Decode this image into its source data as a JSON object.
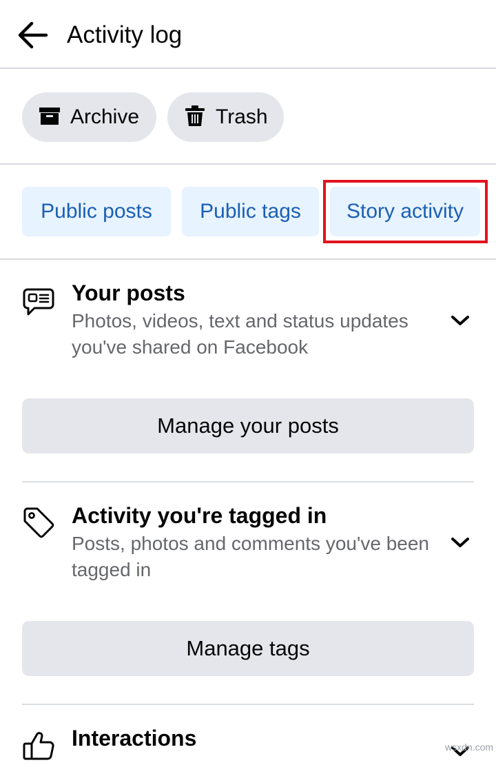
{
  "header": {
    "title": "Activity log"
  },
  "filters": {
    "archive_label": "Archive",
    "trash_label": "Trash"
  },
  "tabs": [
    {
      "label": "Public posts"
    },
    {
      "label": "Public tags"
    },
    {
      "label": "Story activity",
      "highlighted": true
    }
  ],
  "sections": [
    {
      "title": "Your posts",
      "description": "Photos, videos, text and status updates you've shared on Facebook",
      "button": "Manage your posts"
    },
    {
      "title": "Activity you're tagged in",
      "description": "Posts, photos and comments you've been tagged in",
      "button": "Manage tags"
    },
    {
      "title": "Interactions"
    }
  ],
  "watermark": "wsxdn.com",
  "colors": {
    "chip_bg": "#e4e6eb",
    "tab_bg": "#e7f3ff",
    "tab_text": "#1b5fb4",
    "highlight": "#e0141e",
    "secondary_text": "#65676b"
  }
}
